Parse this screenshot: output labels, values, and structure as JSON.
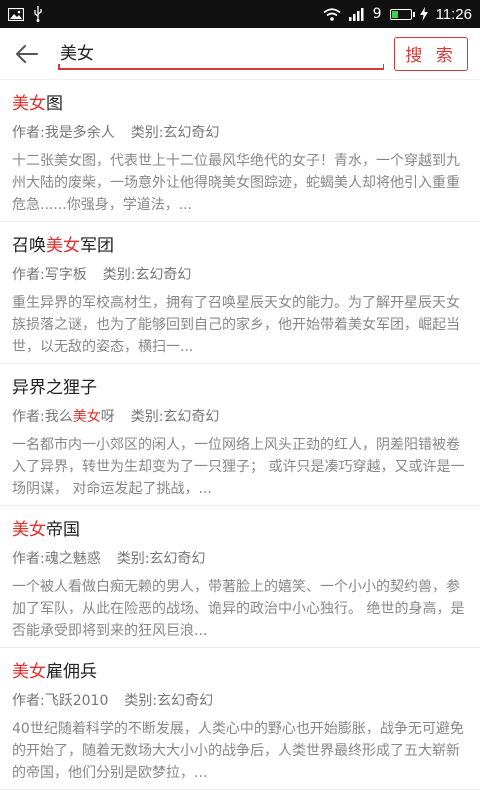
{
  "status_bar": {
    "signal_label": "9",
    "time": "11:26",
    "battery_fraction": 0.3,
    "battery_color": "#39d24a"
  },
  "search": {
    "query": "美女",
    "button_label": "搜 索",
    "accent_color": "#d33a3a"
  },
  "results": [
    {
      "title": [
        {
          "t": "美女",
          "hl": true
        },
        {
          "t": "图",
          "hl": false
        }
      ],
      "author": [
        {
          "t": "作者:我是多余人",
          "hl": false
        }
      ],
      "category": "类别:玄幻奇幻",
      "desc": "十二张美女图，代表世上十二位最风华绝代的女子！青水，一个穿越到九州大陆的废柴，一场意外让他得晓美女图踪迹，蛇蝎美人却将他引入重重危急......你强身，学道法，..."
    },
    {
      "title": [
        {
          "t": "召唤",
          "hl": false
        },
        {
          "t": "美女",
          "hl": true
        },
        {
          "t": "军团",
          "hl": false
        }
      ],
      "author": [
        {
          "t": "作者:写字板",
          "hl": false
        }
      ],
      "category": "类别:玄幻奇幻",
      "desc": "重生异界的军校高材生，拥有了召唤星辰天女的能力。为了解开星辰天女族损落之谜，也为了能够回到自己的家乡，他开始带着美女军团，崛起当世，以无敌的姿态，横扫一..."
    },
    {
      "title": [
        {
          "t": "异界之狸子",
          "hl": false
        }
      ],
      "author": [
        {
          "t": "作者:我么",
          "hl": false
        },
        {
          "t": "美女",
          "hl": true
        },
        {
          "t": "呀",
          "hl": false
        }
      ],
      "category": "类别:玄幻奇幻",
      "desc": "一名都市内一小郊区的闲人，一位网络上风头正劲的红人，阴差阳错被卷入了异界，转世为生却变为了一只狸子； 或许只是凑巧穿越，又或许是一场阴谋， 对命运发起了挑战，..."
    },
    {
      "title": [
        {
          "t": "美女",
          "hl": true
        },
        {
          "t": "帝国",
          "hl": false
        }
      ],
      "author": [
        {
          "t": "作者:魂之魅惑",
          "hl": false
        }
      ],
      "category": "类别:玄幻奇幻",
      "desc": "一个被人看做白痴无赖的男人，带著脸上的嬉笑、一个小小的契约兽，参加了军队，从此在险恶的战场、诡异的政治中小心独行。 绝世的身高，是否能承受即将到来的狂风巨浪..."
    },
    {
      "title": [
        {
          "t": "美女",
          "hl": true
        },
        {
          "t": "雇佣兵",
          "hl": false
        }
      ],
      "author": [
        {
          "t": "作者:飞跃2010",
          "hl": false
        }
      ],
      "category": "类别:玄幻奇幻",
      "desc": "40世纪随着科学的不断发展，人类心中的野心也开始膨胀，战争无可避免的开始了，随着无数场大大小小的战争后，人类世界最终形成了五大崭新的帝国，他们分别是欧梦拉，..."
    }
  ]
}
